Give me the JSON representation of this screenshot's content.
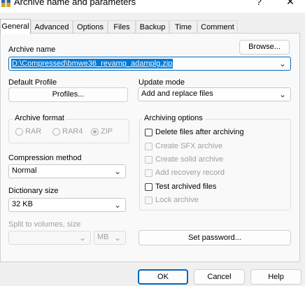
{
  "window": {
    "title": "Archive name and parameters",
    "help_glyph": "?",
    "close_glyph": "✕"
  },
  "tabs": [
    {
      "label": "General",
      "active": true
    },
    {
      "label": "Advanced"
    },
    {
      "label": "Options"
    },
    {
      "label": "Files"
    },
    {
      "label": "Backup"
    },
    {
      "label": "Time"
    },
    {
      "label": "Comment"
    }
  ],
  "general": {
    "archive_name_label": "Archive name",
    "archive_name_value": "D:\\Compressed\\bmwe36_revamp_adamplg.zip",
    "browse_label": "Browse...",
    "default_profile_label": "Default Profile",
    "profiles_label": "Profiles...",
    "update_mode_label": "Update mode",
    "update_mode_value": "Add and replace files",
    "archive_format_label": "Archive format",
    "formats": [
      "RAR",
      "RAR4",
      "ZIP"
    ],
    "selected_format": "ZIP",
    "compression_method_label": "Compression method",
    "compression_method_value": "Normal",
    "dictionary_size_label": "Dictionary size",
    "dictionary_size_value": "32 KB",
    "split_label": "Split to volumes, size",
    "split_unit": "MB",
    "archiving_options_label": "Archiving options",
    "options": [
      {
        "label": "Delete files after archiving",
        "enabled": true,
        "checked": false
      },
      {
        "label": "Create SFX archive",
        "enabled": false,
        "checked": false
      },
      {
        "label": "Create solid archive",
        "enabled": false,
        "checked": false
      },
      {
        "label": "Add recovery record",
        "enabled": false,
        "checked": false
      },
      {
        "label": "Test archived files",
        "enabled": true,
        "checked": false
      },
      {
        "label": "Lock archive",
        "enabled": false,
        "checked": false
      }
    ],
    "set_password_label": "Set password..."
  },
  "footer": {
    "ok_label": "OK",
    "cancel_label": "Cancel",
    "help_label": "Help"
  },
  "colors": {
    "accent": "#0067c0",
    "selection": "#0078d7"
  }
}
